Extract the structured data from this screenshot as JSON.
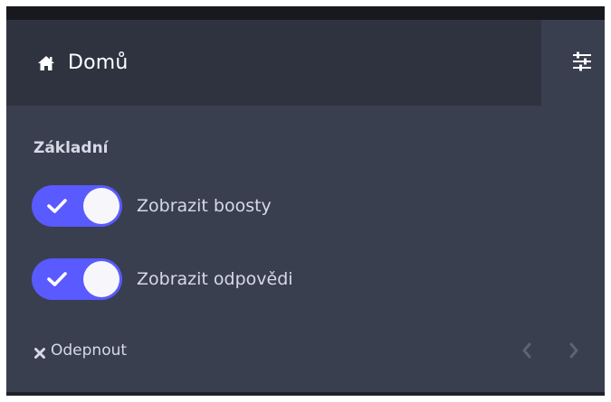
{
  "header": {
    "home_icon": "home-icon",
    "title": "Domů",
    "settings_icon": "sliders-icon"
  },
  "section": {
    "title": "Základní"
  },
  "toggles": [
    {
      "label": "Zobrazit boosty",
      "checked": true
    },
    {
      "label": "Zobrazit odpovědi",
      "checked": true
    }
  ],
  "footer": {
    "unpin_icon": "close-icon",
    "unpin_label": "Odepnout",
    "prev_icon": "chevron-left-icon",
    "next_icon": "chevron-right-icon"
  },
  "colors": {
    "panel_bg": "#393f4f",
    "header_bg": "#2f3340",
    "toggle_on": "#595aff",
    "text": "#d6dae6"
  }
}
